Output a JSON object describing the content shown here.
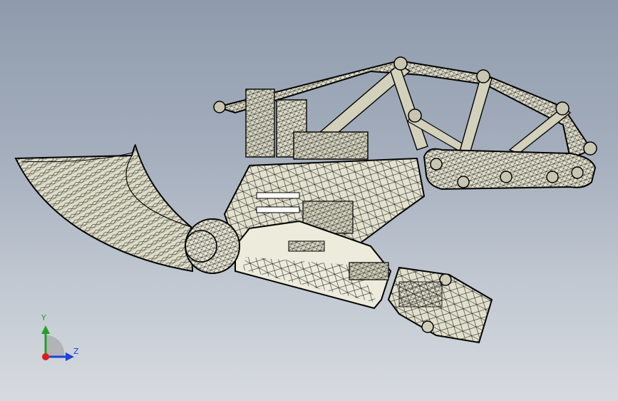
{
  "triad": {
    "y_label": "Y",
    "z_label": "Z"
  },
  "colors": {
    "background_top": "#8f9bac",
    "background_bottom": "#d7dbe0",
    "model_fill": "#e4e2cf",
    "model_fill_shadow": "#c9c7b3",
    "mesh_line": "#111111",
    "axis_y": "#23a023",
    "axis_z": "#1e44d6",
    "axis_x": "#d91e1e"
  }
}
